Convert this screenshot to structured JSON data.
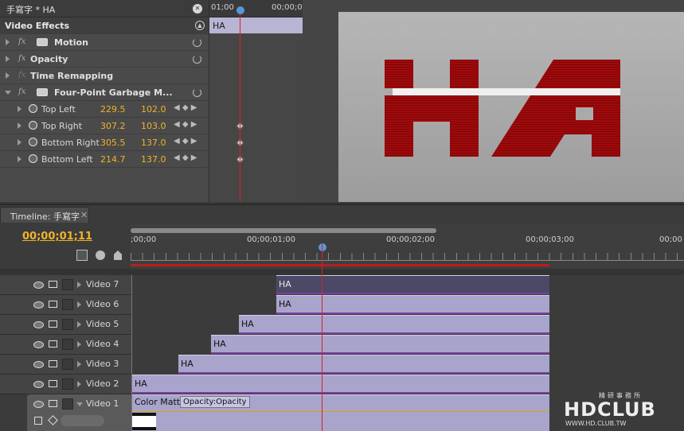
{
  "effect_controls": {
    "tab_title": "手寫字 * HA",
    "video_effects_label": "Video Effects",
    "effects": [
      {
        "name": "Motion",
        "expanded": false,
        "has_icon": true,
        "has_reset": true
      },
      {
        "name": "Opacity",
        "expanded": false,
        "has_icon": false,
        "has_reset": true
      },
      {
        "name": "Time Remapping",
        "expanded": false,
        "has_icon": false,
        "has_reset": false
      },
      {
        "name": "Four-Point Garbage M...",
        "expanded": true,
        "has_icon": true,
        "has_reset": true
      }
    ],
    "params": [
      {
        "label": "Top Left",
        "x": "229.5",
        "y": "102.0"
      },
      {
        "label": "Top Right",
        "x": "307.2",
        "y": "103.0"
      },
      {
        "label": "Bottom Right",
        "x": "305.5",
        "y": "137.0"
      },
      {
        "label": "Bottom Left",
        "x": "214.7",
        "y": "137.0"
      }
    ],
    "ruler_start": "01;00",
    "ruler_end": "00;00;0",
    "clip_label": "HA"
  },
  "program_monitor": {
    "preview_text": "HA",
    "colors": {
      "letter": "#a00a0c",
      "stripe": "#f0f0f0"
    }
  },
  "timeline": {
    "tab_title": "Timeline: 手寫字",
    "timecode": "00;00;01;11",
    "ruler_labels": [
      ";00;00",
      "00;00;01;00",
      "00;00;02;00",
      "00;00;03;00",
      "00;00"
    ],
    "tracks": [
      {
        "name": "Video 7",
        "clip": "HA"
      },
      {
        "name": "Video 6",
        "clip": "HA"
      },
      {
        "name": "Video 5",
        "clip": "HA"
      },
      {
        "name": "Video 4",
        "clip": "HA"
      },
      {
        "name": "Video 3",
        "clip": "HA"
      },
      {
        "name": "Video 2",
        "clip": "HA"
      },
      {
        "name": "Video 1",
        "clip": "Color Matte",
        "opacity_label": "Opacity:Opacity"
      }
    ]
  },
  "watermark": {
    "top": "精研事務所",
    "logo": "HDCLUB",
    "url": "WWW.HD.CLUB.TW"
  }
}
